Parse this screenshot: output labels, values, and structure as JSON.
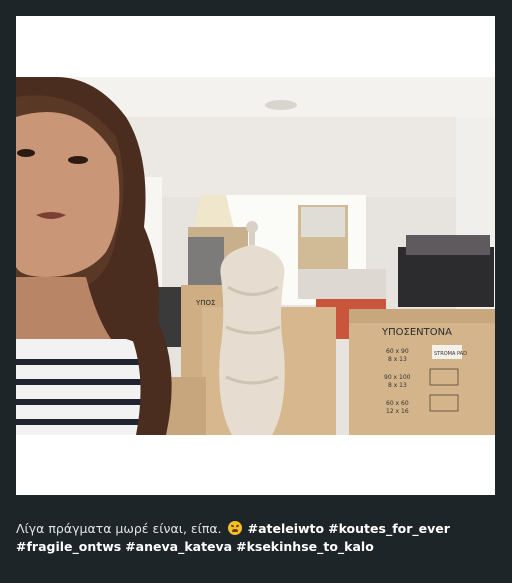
{
  "caption": {
    "text_before": "Λίγα πράγματα μωρέ είναι, είπα.",
    "emoji_icon": "weary-face-icon",
    "hashtags": [
      "#ateleiwto",
      "#koutes_for_ever",
      "#fragile_ontws",
      "#aneva_kateva",
      "#ksekinhse_to_kalo"
    ]
  },
  "photo": {
    "box_label": "ΥΠΟΣΕΝΤΟΝΑ",
    "box_sizes": [
      "60 x 90",
      "8 x 13",
      "90 x 100",
      "8 x 13",
      "60 x 60",
      "12 x 16"
    ],
    "box_tag": "STROMA PAD",
    "left_box_label": "ΥΠΟΣ"
  },
  "colors": {
    "background": "#1e2529",
    "card": "#ffffff",
    "caption_text": "#e9edef"
  }
}
